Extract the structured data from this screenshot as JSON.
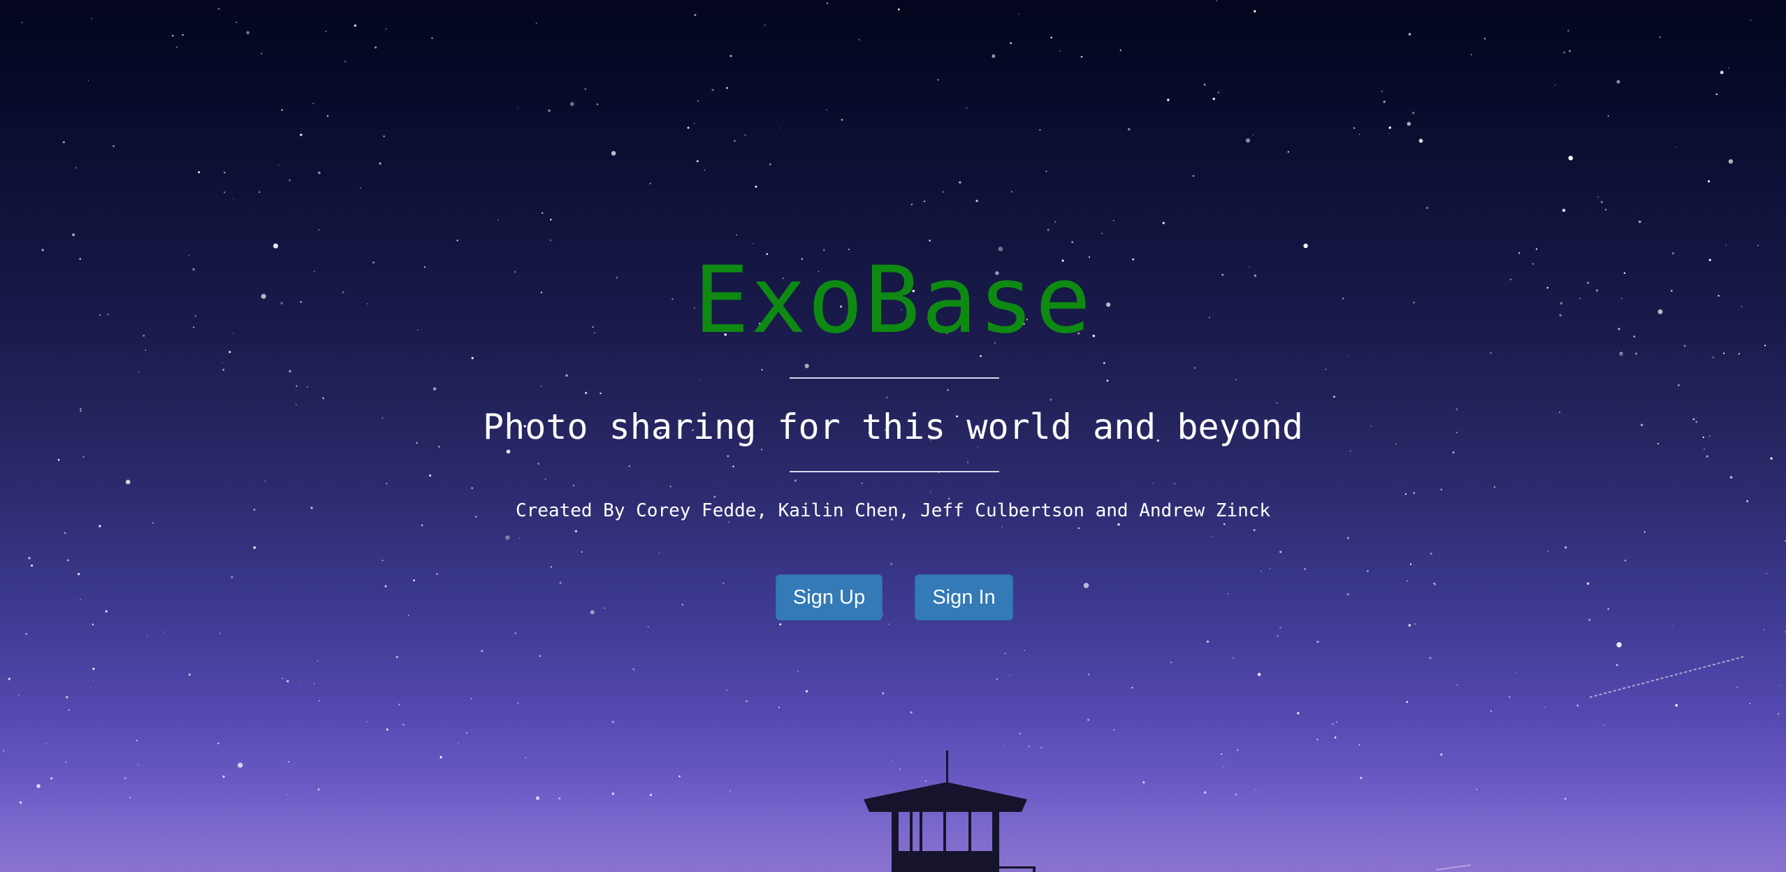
{
  "hero": {
    "title": "ExoBase",
    "tagline": "Photo sharing for this world and beyond",
    "credits": "Created By Corey Fedde, Kailin Chen, Jeff Culbertson and Andrew Zinck"
  },
  "actions": {
    "signup_label": "Sign Up",
    "signin_label": "Sign In"
  },
  "colors": {
    "title": "#0e8a12",
    "button": "#337ab7",
    "sky_top": "#03061d",
    "sky_bottom": "#8370d3"
  }
}
